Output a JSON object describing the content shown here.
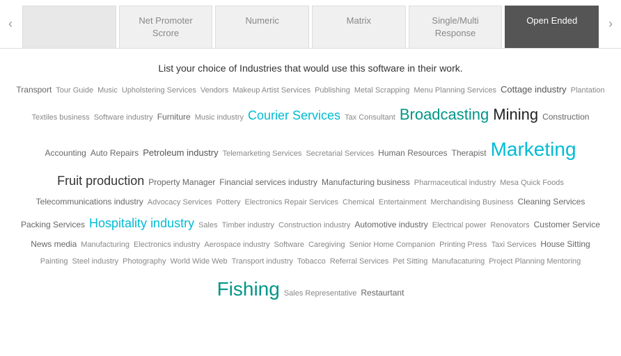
{
  "tabs": [
    {
      "id": "placeholder1",
      "label": "",
      "active": false,
      "placeholder": true
    },
    {
      "id": "net-promoter",
      "label": "Net Promoter Scrore",
      "active": false,
      "placeholder": false
    },
    {
      "id": "numeric",
      "label": "Numeric",
      "active": false,
      "placeholder": false
    },
    {
      "id": "matrix",
      "label": "Matrix",
      "active": false,
      "placeholder": false
    },
    {
      "id": "single-multi",
      "label": "Single/Multi Response",
      "active": false,
      "placeholder": false
    },
    {
      "id": "open-ended",
      "label": "Open Ended",
      "active": true,
      "placeholder": false
    }
  ],
  "nav": {
    "left_arrow": "‹",
    "right_arrow": "›"
  },
  "question": "List your choice of Industries that would use this software in their work.",
  "words": [
    {
      "text": "Transport",
      "size": "sm"
    },
    {
      "text": "Tour Guide",
      "size": "xs"
    },
    {
      "text": "Music",
      "size": "xs"
    },
    {
      "text": "Upholstering Services",
      "size": "xs"
    },
    {
      "text": "Vendors",
      "size": "xs"
    },
    {
      "text": "Makeup Artist Services",
      "size": "xs"
    },
    {
      "text": "Publishing",
      "size": "xs"
    },
    {
      "text": "Metal Scrapping",
      "size": "xs"
    },
    {
      "text": "Menu Planning Services",
      "size": "xs"
    },
    {
      "text": "Cottage industry",
      "size": "md"
    },
    {
      "text": "Plantation",
      "size": "xs"
    },
    {
      "text": "Textiles business",
      "size": "xs"
    },
    {
      "text": "Software industry",
      "size": "xs"
    },
    {
      "text": "Furniture",
      "size": "sm"
    },
    {
      "text": "Music industry",
      "size": "xs"
    },
    {
      "text": "Courier Services",
      "size": "xl",
      "style": "highlight-cyan"
    },
    {
      "text": "Tax Consultant",
      "size": "xs"
    },
    {
      "text": "Broadcasting",
      "size": "xxl",
      "style": "highlight-teal"
    },
    {
      "text": "Mining",
      "size": "xxl"
    },
    {
      "text": "Construction",
      "size": "sm"
    },
    {
      "text": "Accounting",
      "size": "sm"
    },
    {
      "text": "Auto Repairs",
      "size": "sm"
    },
    {
      "text": "Petroleum industry",
      "size": "md"
    },
    {
      "text": "Telemarketing Services",
      "size": "xs"
    },
    {
      "text": "Secretarial Services",
      "size": "xs"
    },
    {
      "text": "Human Resources",
      "size": "sm"
    },
    {
      "text": "Therapist",
      "size": "sm"
    },
    {
      "text": "Marketing",
      "size": "xxxl",
      "style": "highlight-cyan"
    },
    {
      "text": "Fruit production",
      "size": "xl"
    },
    {
      "text": "Property Manager",
      "size": "sm"
    },
    {
      "text": "Financial services industry",
      "size": "sm"
    },
    {
      "text": "Manufacturing business",
      "size": "sm"
    },
    {
      "text": "Pharmaceutical industry",
      "size": "xs"
    },
    {
      "text": "Mesa Quick Foods",
      "size": "xs"
    },
    {
      "text": "Telecommunications industry",
      "size": "sm"
    },
    {
      "text": "Advocacy Services",
      "size": "xs"
    },
    {
      "text": "Pottery",
      "size": "xs"
    },
    {
      "text": "Electronics Repair Services",
      "size": "xs"
    },
    {
      "text": "Chemical",
      "size": "xs"
    },
    {
      "text": "Entertainment",
      "size": "xs"
    },
    {
      "text": "Merchandising Business",
      "size": "xs"
    },
    {
      "text": "Cleaning Services",
      "size": "sm"
    },
    {
      "text": "Packing Services",
      "size": "sm"
    },
    {
      "text": "Hospitality industry",
      "size": "xl",
      "style": "highlight-cyan"
    },
    {
      "text": "Sales",
      "size": "xs"
    },
    {
      "text": "Timber industry",
      "size": "xs"
    },
    {
      "text": "Construction industry",
      "size": "xs"
    },
    {
      "text": "Automotive industry",
      "size": "sm"
    },
    {
      "text": "Electrical power",
      "size": "xs"
    },
    {
      "text": "Renovators",
      "size": "xs"
    },
    {
      "text": "Customer Service",
      "size": "sm"
    },
    {
      "text": "News media",
      "size": "sm"
    },
    {
      "text": "Manufacturing",
      "size": "xs"
    },
    {
      "text": "Electronics industry",
      "size": "xs"
    },
    {
      "text": "Aerospace industry",
      "size": "xs"
    },
    {
      "text": "Software",
      "size": "xs"
    },
    {
      "text": "Caregiving",
      "size": "xs"
    },
    {
      "text": "Senior Home Companion",
      "size": "xs"
    },
    {
      "text": "Printing Press",
      "size": "xs"
    },
    {
      "text": "Taxi Services",
      "size": "xs"
    },
    {
      "text": "House Sitting",
      "size": "sm"
    },
    {
      "text": "Painting",
      "size": "xs"
    },
    {
      "text": "Steel industry",
      "size": "xs"
    },
    {
      "text": "Photography",
      "size": "xs"
    },
    {
      "text": "World Wide Web",
      "size": "xs"
    },
    {
      "text": "Transport industry",
      "size": "xs"
    },
    {
      "text": "Tobacco",
      "size": "xs"
    },
    {
      "text": "Referral Services",
      "size": "xs"
    },
    {
      "text": "Pet Sitting",
      "size": "xs"
    },
    {
      "text": "Manufacaturing",
      "size": "xs"
    },
    {
      "text": "Project Planning Mentoring",
      "size": "xs"
    },
    {
      "text": "Fishing",
      "size": "xxxl",
      "style": "highlight-teal"
    },
    {
      "text": "Sales Representative",
      "size": "xs"
    },
    {
      "text": "Restaurtant",
      "size": "sm"
    }
  ]
}
